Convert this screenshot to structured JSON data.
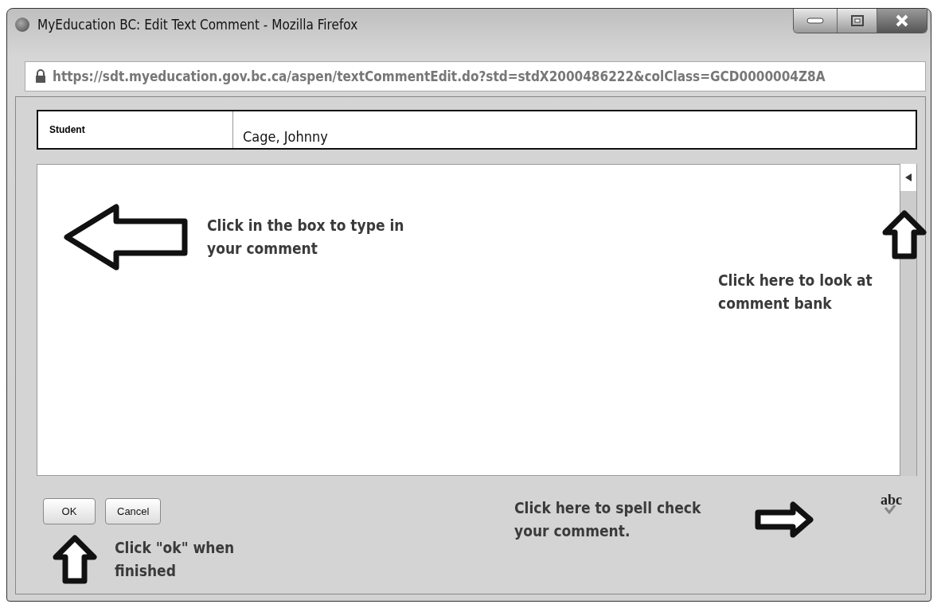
{
  "window": {
    "title": "MyEducation BC: Edit Text Comment - Mozilla Firefox"
  },
  "address_bar": {
    "url": "https://sdt.myeducation.gov.bc.ca/aspen/textCommentEdit.do?std=stdX2000486222&colClass=GCD0000004Z8A"
  },
  "student": {
    "label": "Student",
    "value": "Cage, Johnny"
  },
  "comment_box": {
    "hint": {
      "text": "Click in the box to type in your comment",
      "kind": "left"
    }
  },
  "comment_bank": {
    "hint": {
      "text": "Click here to look at comment bank",
      "kind": "up"
    }
  },
  "buttons": [
    "OK",
    "Cancel"
  ],
  "ok_hint": {
    "text": "Click \"ok\" when finished",
    "kind": "up"
  },
  "spell_check": {
    "label": "abc",
    "hint": {
      "text": "Click here to spell check your comment.",
      "kind": "right"
    }
  }
}
